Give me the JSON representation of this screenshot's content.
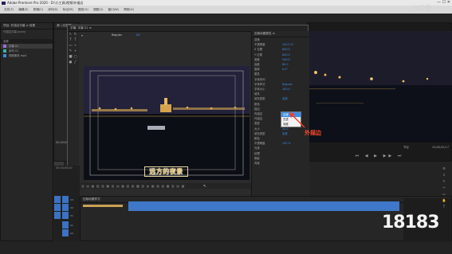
{
  "app": {
    "title": "Adobe Premiere Pro 2020 - D:\\小工具\\视频\\外描边",
    "window_controls": "— ☐ ✕"
  },
  "menu": [
    "文件(F)",
    "编辑(E)",
    "剪辑(C)",
    "序列(S)",
    "标记(M)",
    "图形(G)",
    "视图(V)",
    "窗口(W)",
    "帮助(H)"
  ],
  "project": {
    "tabs": "项目: 外描边字幕 ≡   效果",
    "name": "外描边字幕.prproj",
    "folder_label": "名称",
    "items": [
      {
        "name": "字幕 01",
        "color": "#9b6dd8"
      },
      {
        "name": "序列 01",
        "color": "#36b5a0"
      },
      {
        "name": "视频素材.mp4",
        "color": "#3f8bd9"
      }
    ]
  },
  "source_monitor": {
    "tab": "源: (无剪辑)",
    "timecode": "00;00;00;00"
  },
  "title_editor": {
    "tab": "字幕: 字幕 01 ≡",
    "font": "Regular",
    "size": "100",
    "subtitle_text": "远方的夜景",
    "bottom_timecode": "00;00;00;00"
  },
  "properties": {
    "tab": "旧版标题属性 ≡",
    "rows": [
      {
        "label": "变换",
        "value": ""
      },
      {
        "label": "不透明度",
        "value": "100.0 %"
      },
      {
        "label": "X 位置",
        "value": "640.0"
      },
      {
        "label": "Y 位置",
        "value": "600.0"
      },
      {
        "label": "宽度",
        "value": "540.0"
      },
      {
        "label": "高度",
        "value": "80.0"
      },
      {
        "label": "旋转",
        "value": "0.0°"
      },
      {
        "label": "属性",
        "value": ""
      },
      {
        "label": "字体系列",
        "value": ""
      },
      {
        "label": "字体样式",
        "value": "Regular"
      },
      {
        "label": "字体大小",
        "value": "100.0"
      },
      {
        "label": "填充",
        "value": ""
      },
      {
        "label": "填充类型",
        "value": "实底"
      },
      {
        "label": "颜色",
        "value": ""
      },
      {
        "label": "描边",
        "value": ""
      },
      {
        "label": "内描边",
        "value": "添加"
      },
      {
        "label": "外描边",
        "value": "添加"
      },
      {
        "label": "类型",
        "value": "边缘"
      },
      {
        "label": "大小",
        "value": "20.0"
      },
      {
        "label": "填充类型",
        "value": "实底"
      },
      {
        "label": "颜色",
        "value": ""
      },
      {
        "label": "不透明度",
        "value": "100 %"
      },
      {
        "label": "光泽",
        "value": ""
      },
      {
        "label": "纹理",
        "value": ""
      },
      {
        "label": "阴影",
        "value": ""
      },
      {
        "label": "背景",
        "value": ""
      }
    ],
    "dropdown": [
      "边缘",
      "凹进",
      "深度"
    ]
  },
  "program": {
    "label": "节目",
    "timecode": "00;00;05;17"
  },
  "timeline": {
    "tab": "序列 01 ≡",
    "timecode": "00;00;00;00",
    "tracks": [
      "V3",
      "V2",
      "V1",
      "A1",
      "A2",
      "A3"
    ],
    "subtitle_tab": "旧版标题样式"
  },
  "annotation": "外描边",
  "watermark": {
    "logo": "18183",
    "corner": "小红鱼"
  }
}
